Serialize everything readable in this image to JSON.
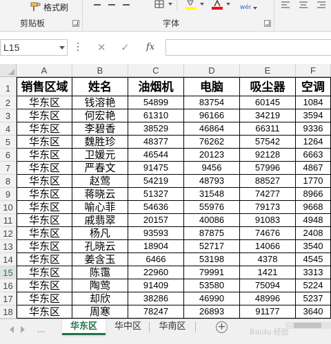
{
  "ribbon": {
    "format_painter_label": "格式刷",
    "clipboard_group": "剪贴板",
    "font_group": "字体",
    "colors": {
      "highlight": "#FFFF00",
      "font_color": "#FF0000"
    }
  },
  "formula_bar": {
    "name_box": "L15",
    "fx_label": "fx",
    "cancel_glyph": "✕",
    "enter_glyph": "✓",
    "formula": ""
  },
  "grid": {
    "columns": [
      "A",
      "B",
      "C",
      "D",
      "E",
      "F"
    ],
    "rows": [
      "1",
      "2",
      "3",
      "4",
      "5",
      "6",
      "7",
      "8",
      "9",
      "10",
      "11",
      "12",
      "13",
      "14",
      "15",
      "16",
      "17",
      "18"
    ],
    "active_row": "15",
    "headers": [
      "销售区域",
      "姓名",
      "油烟机",
      "电脑",
      "吸尘器",
      "空调"
    ],
    "data": [
      [
        "华东区",
        "钱溶艳",
        "54899",
        "83754",
        "60145",
        "1084"
      ],
      [
        "华东区",
        "何宏艳",
        "61310",
        "96166",
        "34219",
        "3594"
      ],
      [
        "华东区",
        "李碧香",
        "38529",
        "46864",
        "66311",
        "9336"
      ],
      [
        "华东区",
        "魏胜珍",
        "48377",
        "76262",
        "57542",
        "1264"
      ],
      [
        "华东区",
        "卫媛元",
        "46544",
        "20123",
        "92128",
        "6663"
      ],
      [
        "华东区",
        "严春文",
        "91475",
        "9456",
        "57996",
        "4867"
      ],
      [
        "华东区",
        "赵莺",
        "54219",
        "48793",
        "88527",
        "1770"
      ],
      [
        "华东区",
        "蒋晓云",
        "51327",
        "31548",
        "74277",
        "8966"
      ],
      [
        "华东区",
        "喻心菲",
        "54636",
        "55976",
        "79173",
        "9668"
      ],
      [
        "华东区",
        "戚翡翠",
        "20157",
        "40086",
        "91083",
        "4948"
      ],
      [
        "华东区",
        "杨凡",
        "93593",
        "87875",
        "74676",
        "2408"
      ],
      [
        "华东区",
        "孔晓云",
        "18904",
        "52717",
        "14066",
        "3540"
      ],
      [
        "华东区",
        "姜含玉",
        "6466",
        "53198",
        "4378",
        "4545"
      ],
      [
        "华东区",
        "陈霭",
        "22960",
        "79991",
        "1421",
        "3313"
      ],
      [
        "华东区",
        "陶莺",
        "91409",
        "53580",
        "75094",
        "5224"
      ],
      [
        "华东区",
        "却欣",
        "38286",
        "46990",
        "48996",
        "5237"
      ],
      [
        "华东区",
        "周寒",
        "78247",
        "26893",
        "91177",
        "3640"
      ]
    ]
  },
  "sheets": {
    "tabs": [
      "华东区",
      "华中区",
      "华南区"
    ],
    "active": "华东区",
    "more": "...",
    "add_glyph": "+"
  },
  "watermark": "Baidu 经验"
}
